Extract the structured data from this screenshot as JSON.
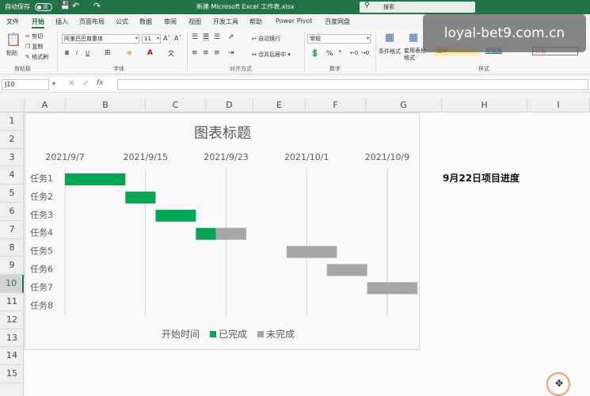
{
  "titlebar": {
    "autosave": "自动保存",
    "autosave_state": "关",
    "filename": "新建 Microsoft Excel 工作表.xlsx",
    "search_placeholder": "搜索"
  },
  "menu": [
    "文件",
    "开始",
    "插入",
    "页面布局",
    "公式",
    "数据",
    "审阅",
    "视图",
    "开发工具",
    "帮助",
    "Power Pivot",
    "百度网盘"
  ],
  "menu_active": 1,
  "ribbon": {
    "clipboard": {
      "paste": "粘贴",
      "cut": "剪切",
      "copy": "复制",
      "painter": "格式刷",
      "group": "剪贴板"
    },
    "font": {
      "name": "阿里巴巴普惠体",
      "size": "11",
      "group": "字体"
    },
    "align": {
      "wrap": "自动换行",
      "merge": "合并后居中",
      "group": "对齐方式"
    },
    "number": {
      "format": "常规",
      "group": "数字"
    },
    "styles": {
      "cond": "条件格式",
      "table": "套用表格格式",
      "neutral": "适中",
      "hyperlink": "超链接",
      "calc": "计算",
      "group": "样式"
    }
  },
  "formula_bar": {
    "name_box": "J10",
    "formula": ""
  },
  "columns": [
    "A",
    "B",
    "C",
    "D",
    "E",
    "F",
    "G",
    "H",
    "I"
  ],
  "rows": [
    "1",
    "2",
    "3",
    "4",
    "5",
    "6",
    "7",
    "8",
    "9",
    "10",
    "11",
    "12",
    "13",
    "14",
    "15"
  ],
  "selected_row": "10",
  "side_note": "9月22日项目进度",
  "watermark": "loyal-bet9.com.cn",
  "colors": {
    "excel_green": "#217346",
    "done": "#00a651",
    "pending": "#a6a6a6",
    "ring": "#f0a25a"
  },
  "chart_data": {
    "type": "bar",
    "subtype": "gantt-stacked-horizontal",
    "title": "图表标题",
    "categories": [
      "任务1",
      "任务2",
      "任务3",
      "任务4",
      "任务5",
      "任务6",
      "任务7",
      "任务8"
    ],
    "x_tick_labels": [
      "2021/9/7",
      "2021/9/15",
      "2021/9/23",
      "2021/10/1",
      "2021/10/9"
    ],
    "x_axis_position": "top",
    "xlim": [
      "2021/9/7",
      "2021/10/9"
    ],
    "series": [
      {
        "name": "开始时间",
        "values": [
          "2021/9/7",
          "2021/9/13",
          "2021/9/16",
          "2021/9/20",
          "2021/9/29",
          "2021/10/3",
          "2021/10/7",
          null
        ]
      },
      {
        "name": "已完成",
        "values": [
          6,
          3,
          4,
          2,
          0,
          0,
          0,
          null
        ]
      },
      {
        "name": "未完成",
        "values": [
          0,
          0,
          0,
          3,
          5,
          4,
          5,
          null
        ]
      }
    ],
    "legend": [
      "开始时间",
      "已完成",
      "未完成"
    ],
    "legend_position": "bottom",
    "grid": true
  }
}
